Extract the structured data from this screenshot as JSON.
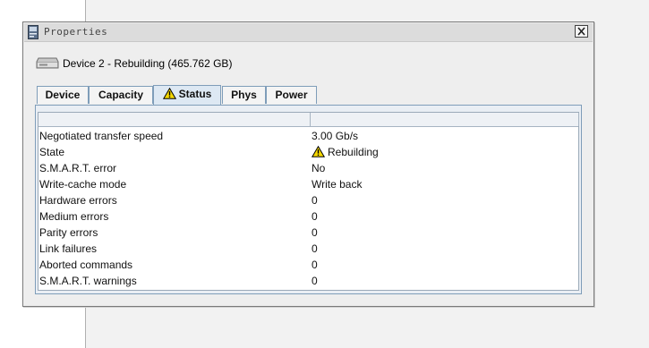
{
  "dialog": {
    "title": "Properties",
    "icons": {
      "app": "window-app-icon",
      "close": "close-icon"
    }
  },
  "device": {
    "icon": "hard-drive-icon",
    "title": "Device 2 - Rebuilding (465.762 GB)"
  },
  "tabs": [
    {
      "label": "Device",
      "active": false
    },
    {
      "label": "Capacity",
      "active": false
    },
    {
      "label": "Status",
      "active": true,
      "icon": "warning-icon"
    },
    {
      "label": "Phys",
      "active": false
    },
    {
      "label": "Power",
      "active": false
    }
  ],
  "table": {
    "headers": [
      "",
      ""
    ],
    "rows": [
      {
        "name": "Negotiated transfer speed",
        "value": "3.00 Gb/s"
      },
      {
        "name": "State",
        "value": "Rebuilding",
        "icon": "warning-icon"
      },
      {
        "name": "S.M.A.R.T. error",
        "value": "No"
      },
      {
        "name": "Write-cache mode",
        "value": "Write back"
      },
      {
        "name": "Hardware errors",
        "value": "0"
      },
      {
        "name": "Medium errors",
        "value": "0"
      },
      {
        "name": "Parity errors",
        "value": "0"
      },
      {
        "name": "Link failures",
        "value": "0"
      },
      {
        "name": "Aborted commands",
        "value": "0"
      },
      {
        "name": "S.M.A.R.T. warnings",
        "value": "0"
      }
    ]
  },
  "colors": {
    "tab_border": "#7f9db9",
    "active_tab_bg": "#dde8f3",
    "warning_fill": "#f5d800"
  }
}
